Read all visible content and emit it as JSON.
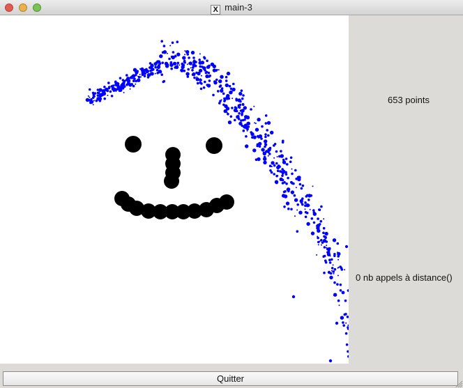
{
  "window": {
    "title": "main-3"
  },
  "side_panel": {
    "points_text": "653 points",
    "calls_text": "0 nb appels à distance()"
  },
  "buttons": {
    "quit_label": "Quitter"
  },
  "icons": {
    "title_icon": "x11-icon",
    "close": "close-icon",
    "minimize": "minimize-icon",
    "zoom": "zoom-icon",
    "resize": "resize-grip-icon"
  },
  "colors": {
    "point_color": "#0000ff",
    "face_color": "#000000"
  }
}
